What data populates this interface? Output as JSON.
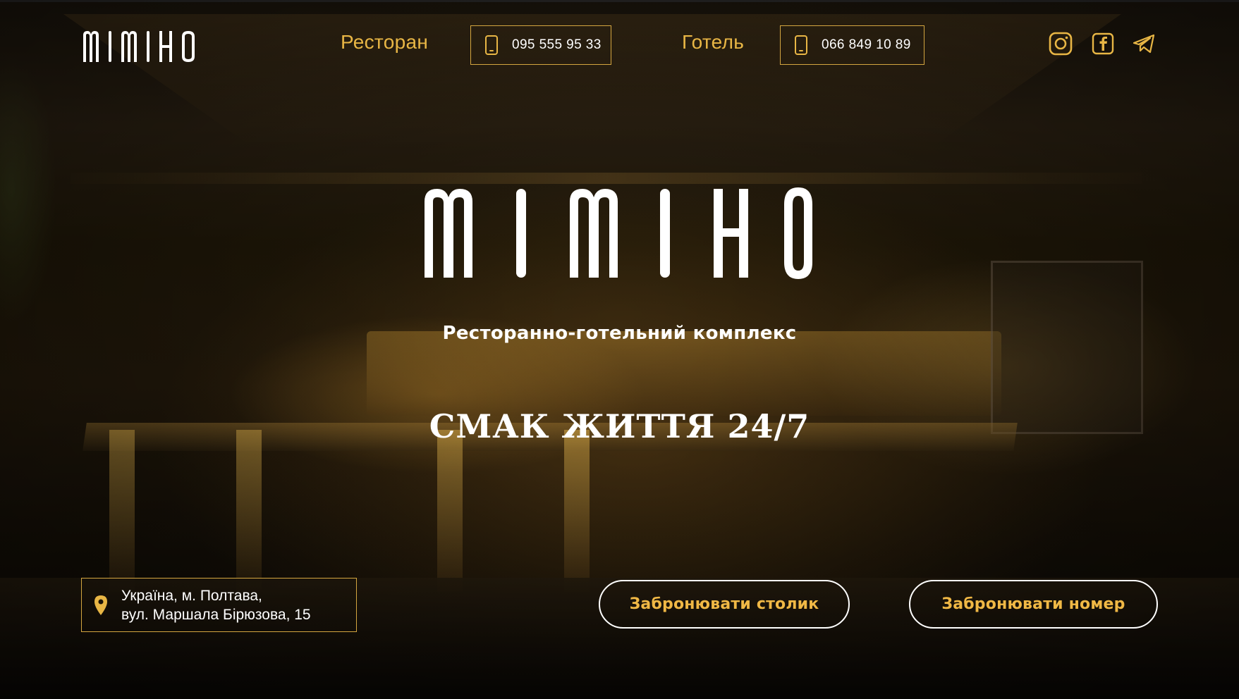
{
  "brand": {
    "name": "MIMIHO",
    "accent_color": "#e8b645",
    "text_color": "#ffffff"
  },
  "header": {
    "restaurant_label": "Ресторан",
    "restaurant_phone": "095 555 95 33",
    "hotel_label": "Готель",
    "hotel_phone": "066 849 10 89",
    "phone_icon": "mobile-phone-icon",
    "socials": [
      "instagram-icon",
      "facebook-icon",
      "telegram-icon"
    ]
  },
  "hero": {
    "subtitle": "Ресторанно-готельний комплекс",
    "tagline": "СМАК ЖИТТЯ 24/7"
  },
  "address": {
    "icon": "location-pin-icon",
    "line1": "Україна, м. Полтава,",
    "line2": "вул. Маршала Бірюзова, 15"
  },
  "actions": {
    "book_table": "Забронювати столик",
    "book_room": "Забронювати номер"
  }
}
